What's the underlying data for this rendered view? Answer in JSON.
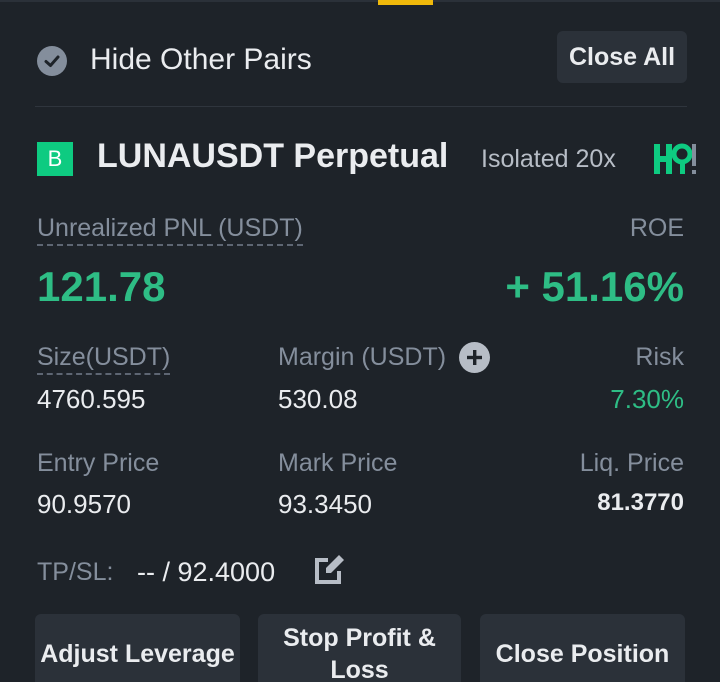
{
  "header": {
    "hide_other_pairs": "Hide Other Pairs",
    "close_all": "Close All"
  },
  "position": {
    "side_badge": "B",
    "symbol": "LUNAUSDT Perpetual",
    "margin_mode": "Isolated 20x",
    "unrealized_pnl_label": "Unrealized PNL (USDT)",
    "unrealized_pnl_value": "121.78",
    "roe_label": "ROE",
    "roe_value": "+ 51.16%",
    "size_label": "Size(USDT)",
    "size_value": "4760.595",
    "margin_label": "Margin (USDT)",
    "margin_value": "530.08",
    "risk_label": "Risk",
    "risk_value": "7.30%",
    "entry_price_label": "Entry Price",
    "entry_price_value": "90.9570",
    "mark_price_label": "Mark Price",
    "mark_price_value": "93.3450",
    "liq_price_label": "Liq. Price",
    "liq_price_value": "81.3770",
    "tpsl_label": "TP/SL:",
    "tpsl_value": "-- / 92.4000"
  },
  "actions": {
    "adjust_leverage": "Adjust Leverage",
    "stop_profit_loss": "Stop Profit & Loss",
    "close_position": "Close Position"
  },
  "colors": {
    "background": "#1e2329",
    "profit_green": "#2ebd85",
    "accent_yellow": "#f0b90b",
    "button_bg": "#2b3139",
    "muted_text": "#848e9c"
  },
  "icons": {
    "check": "check-circle-icon",
    "plus": "plus-circle-icon",
    "edit": "edit-icon",
    "share": "share-icon"
  }
}
